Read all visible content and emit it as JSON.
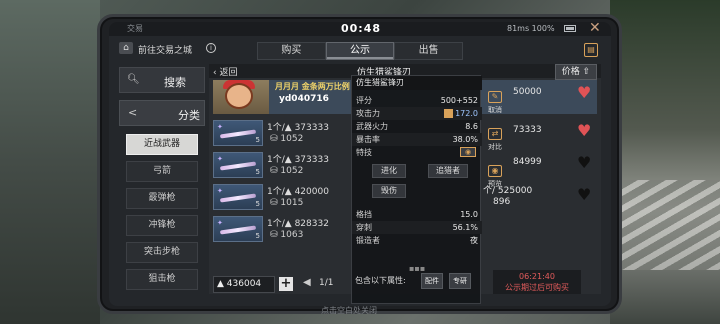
{
  "status": {
    "title": "交易",
    "timer": "00:48",
    "network": "81ms 100%",
    "close_glyph": "✕"
  },
  "location": {
    "text": "前往交易之城"
  },
  "tabs": [
    {
      "label": "购买"
    },
    {
      "label": "公示"
    },
    {
      "label": "出售"
    }
  ],
  "nav": {
    "search_label": "搜索",
    "category_label": "分类",
    "categories": [
      "近战武器",
      "弓箭",
      "霰弹枪",
      "冲锋枪",
      "突击步枪",
      "狙击枪"
    ],
    "selected_index": 0
  },
  "panel": {
    "back_label": "返回",
    "title": "仿生猎鲨锋刃",
    "sort_label": "价格",
    "banner": {
      "line1": "月月月 金条两万比例",
      "line2": "yd040716"
    },
    "rows": [
      {
        "qty": "1个/",
        "price": "373333",
        "sub": "1052",
        "right": "73333",
        "heart": "red"
      },
      {
        "qty": "1个/",
        "price": "373333",
        "sub": "1052",
        "right": "84999",
        "heart": "dark"
      },
      {
        "qty": "1个/",
        "price": "420000",
        "sub": "1015",
        "right": "个/ 525000",
        "right2": "896",
        "heart": "dark"
      },
      {
        "qty": "1个/",
        "price": "828332",
        "sub": "1063",
        "right": "",
        "heart": ""
      }
    ],
    "banner_right": "50000",
    "banner_heart": "red",
    "balance": "436004",
    "page": "1/1",
    "page_prev": "◀"
  },
  "detail": {
    "title": "仿生猎鲨锋刃",
    "stats": [
      {
        "k": "评分",
        "v": "500+552",
        "style": ""
      },
      {
        "k": "攻击力",
        "v": "172.0",
        "style": "blue"
      },
      {
        "k": "武器火力",
        "v": "8.6",
        "style": ""
      },
      {
        "k": "暴击率",
        "v": "38.0%",
        "style": ""
      },
      {
        "k": "特技",
        "v": "",
        "style": ""
      }
    ],
    "chips": [
      "进化",
      "追猎者",
      "毁伤"
    ],
    "stats2": [
      {
        "k": "格挡",
        "v": "15.0"
      },
      {
        "k": "穿刺",
        "v": "56.1%"
      },
      {
        "k": "锻造者",
        "v": "夜"
      }
    ],
    "dots": "▪▪▪",
    "actions": [
      "取消",
      "对比",
      "预览"
    ],
    "attr_label": "包含以下属性:",
    "attr_buttons": [
      "配件",
      "专研"
    ]
  },
  "time_info": {
    "time": "06:21:40",
    "notice": "公示期过后可购买"
  },
  "hint": "点击空白处关闭"
}
